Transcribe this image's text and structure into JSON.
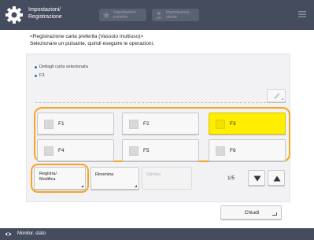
{
  "header": {
    "title_line1": "Impostazioni/",
    "title_line2": "Registrazione",
    "pill1_label_line1": "Impostazioni",
    "pill1_label_line2": "preferite",
    "pill2_label_line1": "Impostazione",
    "pill2_label_line2": "utente",
    "colors": {
      "bar": "#454c5e"
    },
    "icons": [
      "gear-icon",
      "star-icon",
      "user-icon",
      "menu-icon"
    ]
  },
  "message": {
    "line1": "<Registrazione carta preferita (Vassoio multiuso)>",
    "line2": "Selezionare un pulsante, quindi eseguire le operazioni."
  },
  "details": {
    "line1": "Dettagli carta selezionata",
    "line2": "F3"
  },
  "favorites": [
    {
      "label": "F1",
      "selected": false
    },
    {
      "label": "F2",
      "selected": false
    },
    {
      "label": "F3",
      "selected": true
    },
    {
      "label": "F4",
      "selected": false
    },
    {
      "label": "F5",
      "selected": false
    },
    {
      "label": "F6",
      "selected": false
    }
  ],
  "actions": {
    "register_line1": "Registra/",
    "register_line2": "Modifica",
    "rename": "Rinomina",
    "delete": "Elimina"
  },
  "pagination": {
    "indicator": "1/5"
  },
  "close_label": "Chiudi",
  "status": {
    "label": "Monitor. stato"
  },
  "colors": {
    "highlight": "#f5a623",
    "selected": "#ffee00",
    "accent": "#3a66c4"
  }
}
